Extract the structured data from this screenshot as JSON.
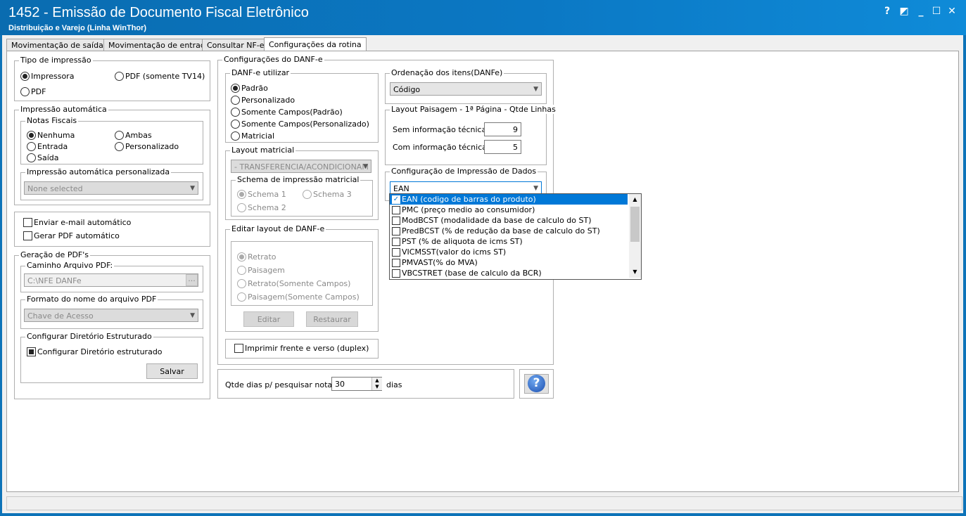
{
  "window": {
    "title": "1452 - Emissão de Documento Fiscal Eletrônico",
    "subtitle": "Distribuição e Varejo (Linha WinThor)",
    "help_btn": "?",
    "minimize_btn": "_",
    "maximize_btn": "☐",
    "close_btn": "✕"
  },
  "tabs": [
    "Movimentação de saída",
    "Movimentação de entrada",
    "Consultar NF-e",
    "Configurações da rotina"
  ],
  "tipo_impressao": {
    "legend": "Tipo de impressão",
    "opt_impressora": "Impressora",
    "opt_pdf_tv14": "PDF (somente TV14)",
    "opt_pdf": "PDF"
  },
  "impressao_automatica": {
    "legend": "Impressão automática",
    "notas_legend": "Notas Fiscais",
    "opt_nenhuma": "Nenhuma",
    "opt_ambas": "Ambas",
    "opt_entrada": "Entrada",
    "opt_personalizado": "Personalizado",
    "opt_saida": "Saída",
    "personalizada_legend": "Impressão automática personalizada",
    "personalizada_value": "None selected"
  },
  "email": {
    "enviar": "Enviar e-mail automático",
    "gerar_pdf": "Gerar PDF automático"
  },
  "geracao_pdf": {
    "legend": "Geração de PDF's",
    "caminho_legend": "Caminho Arquivo PDF:",
    "caminho_value": "C:\\NFE DANFe",
    "browse": "...",
    "formato_legend": "Formato do nome do arquivo PDF",
    "formato_value": "Chave de Acesso",
    "dir_legend": "Configurar Diretório Estruturado",
    "dir_check": "Configurar Diretório estruturado",
    "salvar": "Salvar"
  },
  "danfe": {
    "legend": "Configurações do DANF-e",
    "utilizar_legend": "DANF-e utilizar",
    "opt_padrao": "Padrão",
    "opt_personalizado": "Personalizado",
    "opt_somente_padrao": "Somente Campos(Padrão)",
    "opt_somente_personalizado": "Somente Campos(Personalizado)",
    "opt_matricial": "Matricial",
    "layout_matricial_legend": "Layout matricial",
    "layout_matricial_value": "- TRANSFERENCIA/ACONDICIONAM",
    "schema_legend": "Schema de impressão matricial",
    "schema1": "Schema 1",
    "schema2": "Schema 2",
    "schema3": "Schema 3",
    "editar_legend": "Editar layout de DANF-e",
    "opt_retrato": "Retrato",
    "opt_paisagem": "Paisagem",
    "opt_retrato_somente": "Retrato(Somente Campos)",
    "opt_paisagem_somente": "Paisagem(Somente Campos)",
    "btn_editar": "Editar",
    "btn_restaurar": "Restaurar",
    "duplex": "Imprimir frente e verso (duplex)"
  },
  "ordenacao": {
    "legend": "Ordenação dos itens(DANFe)",
    "value": "Código"
  },
  "layout_paisagem": {
    "legend": "Layout Paisagem - 1ª Página - Qtde Linhas",
    "sem_label": "Sem informação técnica",
    "sem_value": "9",
    "com_label": "Com informação técnica",
    "com_value": "5"
  },
  "config_impressao": {
    "legend": "Configuração de Impressão de Dados",
    "value": "EAN",
    "items": [
      {
        "label": "EAN (codigo de barras do produto)",
        "checked": true
      },
      {
        "label": "PMC (preço medio ao consumidor)",
        "checked": false
      },
      {
        "label": "ModBCST (modalidade da base de calculo do ST)",
        "checked": false
      },
      {
        "label": "PredBCST (% de redução da base de calculo do ST)",
        "checked": false
      },
      {
        "label": "PST (% de aliquota de icms ST)",
        "checked": false
      },
      {
        "label": "VICMSST(valor do icms ST)",
        "checked": false
      },
      {
        "label": "PMVAST(% do MVA)",
        "checked": false
      },
      {
        "label": "VBCSTRET (base de calculo da BCR)",
        "checked": false
      }
    ]
  },
  "qtde_dias": {
    "label": "Qtde dias p/ pesquisar notas:",
    "value": "30",
    "suffix": "dias"
  }
}
